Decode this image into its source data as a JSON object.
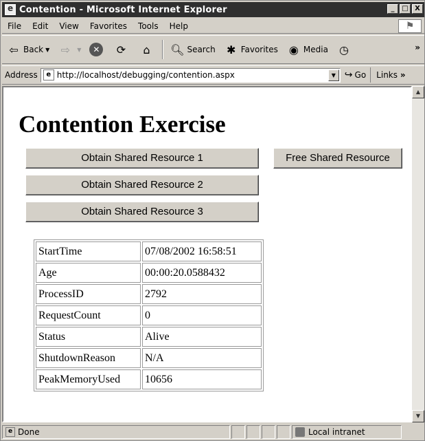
{
  "window": {
    "title": "Contention - Microsoft Internet Explorer",
    "controls": [
      "_",
      "□",
      "X"
    ]
  },
  "menu": [
    "File",
    "Edit",
    "View",
    "Favorites",
    "Tools",
    "Help"
  ],
  "toolbar": {
    "back": "Back",
    "search": "Search",
    "favorites": "Favorites",
    "media": "Media",
    "more": "»"
  },
  "address": {
    "label": "Address",
    "url": "http://localhost/debugging/contention.aspx",
    "go": "Go",
    "links": "Links",
    "links_more": "»"
  },
  "page": {
    "title": "Contention Exercise",
    "buttons": {
      "obtain1": "Obtain Shared Resource 1",
      "obtain2": "Obtain Shared Resource 2",
      "obtain3": "Obtain Shared Resource 3",
      "free": "Free Shared Resource"
    },
    "table": [
      {
        "key": "StartTime",
        "value": "07/08/2002 16:58:51"
      },
      {
        "key": "Age",
        "value": "00:00:20.0588432"
      },
      {
        "key": "ProcessID",
        "value": "2792"
      },
      {
        "key": "RequestCount",
        "value": "0"
      },
      {
        "key": "Status",
        "value": "Alive"
      },
      {
        "key": "ShutdownReason",
        "value": "N/A"
      },
      {
        "key": "PeakMemoryUsed",
        "value": "10656"
      }
    ]
  },
  "status": {
    "text": "Done",
    "zone": "Local intranet"
  }
}
